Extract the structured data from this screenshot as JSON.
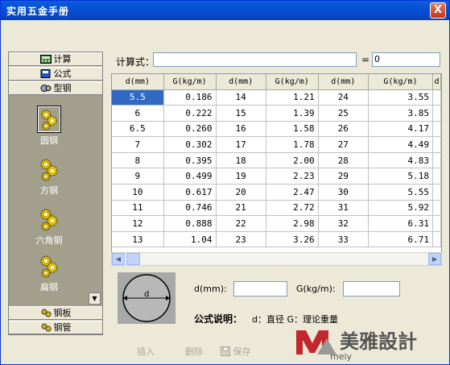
{
  "window": {
    "title": "实用五金手册",
    "close_label": "X"
  },
  "nav": {
    "top_buttons": [
      {
        "label": "计算",
        "icon": "calculator-icon"
      },
      {
        "label": "公式",
        "icon": "formula-book-icon"
      },
      {
        "label": "型钢",
        "icon": "steel-profile-icon"
      }
    ],
    "panel_items": [
      {
        "label": "圆钢",
        "icon": "gear-cluster-icon",
        "selected": true
      },
      {
        "label": "方钢",
        "icon": "gear-cluster-icon",
        "selected": false
      },
      {
        "label": "六角钢",
        "icon": "gear-cluster-icon",
        "selected": false
      },
      {
        "label": "扁钢",
        "icon": "gear-cluster-icon",
        "selected": false
      }
    ],
    "bottom_buttons": [
      {
        "label": "钢板",
        "icon": "gear-cluster-icon"
      },
      {
        "label": "钢管",
        "icon": "gear-cluster-icon"
      }
    ]
  },
  "formula": {
    "label": "计算式：",
    "value": "",
    "equals": "=",
    "result": "0"
  },
  "table": {
    "headers": [
      "d(mm)",
      "G(kg/m)",
      "d(mm)",
      "G(kg/m)",
      "d(mm)",
      "G(kg/m)",
      "d"
    ],
    "rows": [
      [
        "5.5",
        "0.186",
        "14",
        "1.21",
        "24",
        "3.55"
      ],
      [
        "6",
        "0.222",
        "15",
        "1.39",
        "25",
        "3.85"
      ],
      [
        "6.5",
        "0.260",
        "16",
        "1.58",
        "26",
        "4.17"
      ],
      [
        "7",
        "0.302",
        "17",
        "1.78",
        "27",
        "4.49"
      ],
      [
        "8",
        "0.395",
        "18",
        "2.00",
        "28",
        "4.83"
      ],
      [
        "9",
        "0.499",
        "19",
        "2.23",
        "29",
        "5.18"
      ],
      [
        "10",
        "0.617",
        "20",
        "2.47",
        "30",
        "5.55"
      ],
      [
        "11",
        "0.746",
        "21",
        "2.72",
        "31",
        "5.92"
      ],
      [
        "12",
        "0.888",
        "22",
        "2.98",
        "32",
        "6.31"
      ],
      [
        "13",
        "1.04",
        "23",
        "3.26",
        "33",
        "6.71"
      ]
    ],
    "selected_cell": "5.5"
  },
  "inputs": {
    "diagram_label": "d",
    "d_label": "d(mm):",
    "d_value": "",
    "g_label": "G(kg/m):",
    "g_value": "",
    "desc_label": "公式说明：",
    "desc_text": "d：直径 G：理论重量"
  },
  "toolbar": {
    "insert": "插入",
    "delete": "删除",
    "save": "保存"
  },
  "watermark": {
    "text": "美雅設計",
    "url_fragment": "meiy"
  },
  "colors": {
    "title_bar": "#0551d3",
    "selection": "#316ac5",
    "panel": "#a29f8c",
    "background": "#ece9d8",
    "watermark": "#c1272d"
  }
}
